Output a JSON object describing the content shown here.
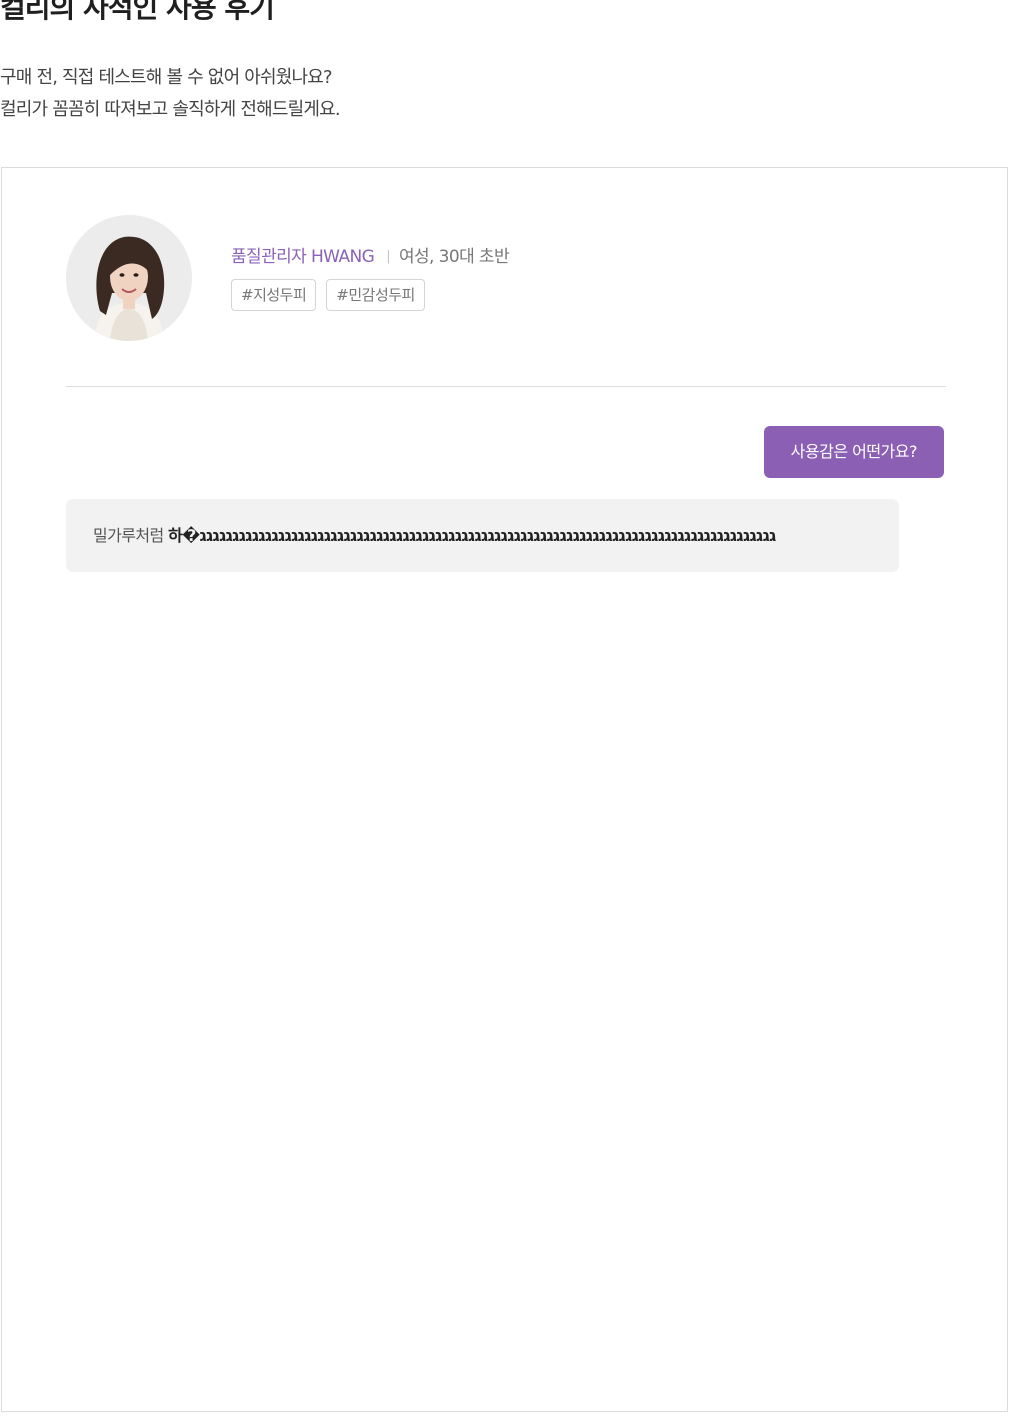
{
  "page": {
    "title": "컬리의 사적인 사용 후기",
    "intro_line1": "구매 전, 직접 테스트해 볼 수 없어 아쉬웠나요?",
    "intro_line2": "컬리가 꼼꼼히 따져보고 솔직하게 전해드릴게요."
  },
  "reviewer": {
    "avatar_icon": "person-photo",
    "role": "품질관리자 HWANG",
    "divider": "|",
    "demographic": "여성, 30대 초반",
    "tags": [
      "#지성두피",
      "#민감성두피"
    ]
  },
  "colors": {
    "accent": "#8b5fb4",
    "bubble": "#f2f2f2"
  },
  "qa": [
    {
      "question": "사용감은 어떤가요?",
      "answer_lines": [
        [
          {
            "t": "밀가루처럼 ",
            "b": false
          },
          {
            "t": "하�גגגגגגגגגגגגגגגגגגגגגגגגגגגגגגגגגגגגגגגגגגגגגגגגגגגגגגגגגגגגגגגגגגגגגגגגגגגגגגגגגגגגגגגג",
            "b": true
          }
        ]
      ]
    }
  ]
}
